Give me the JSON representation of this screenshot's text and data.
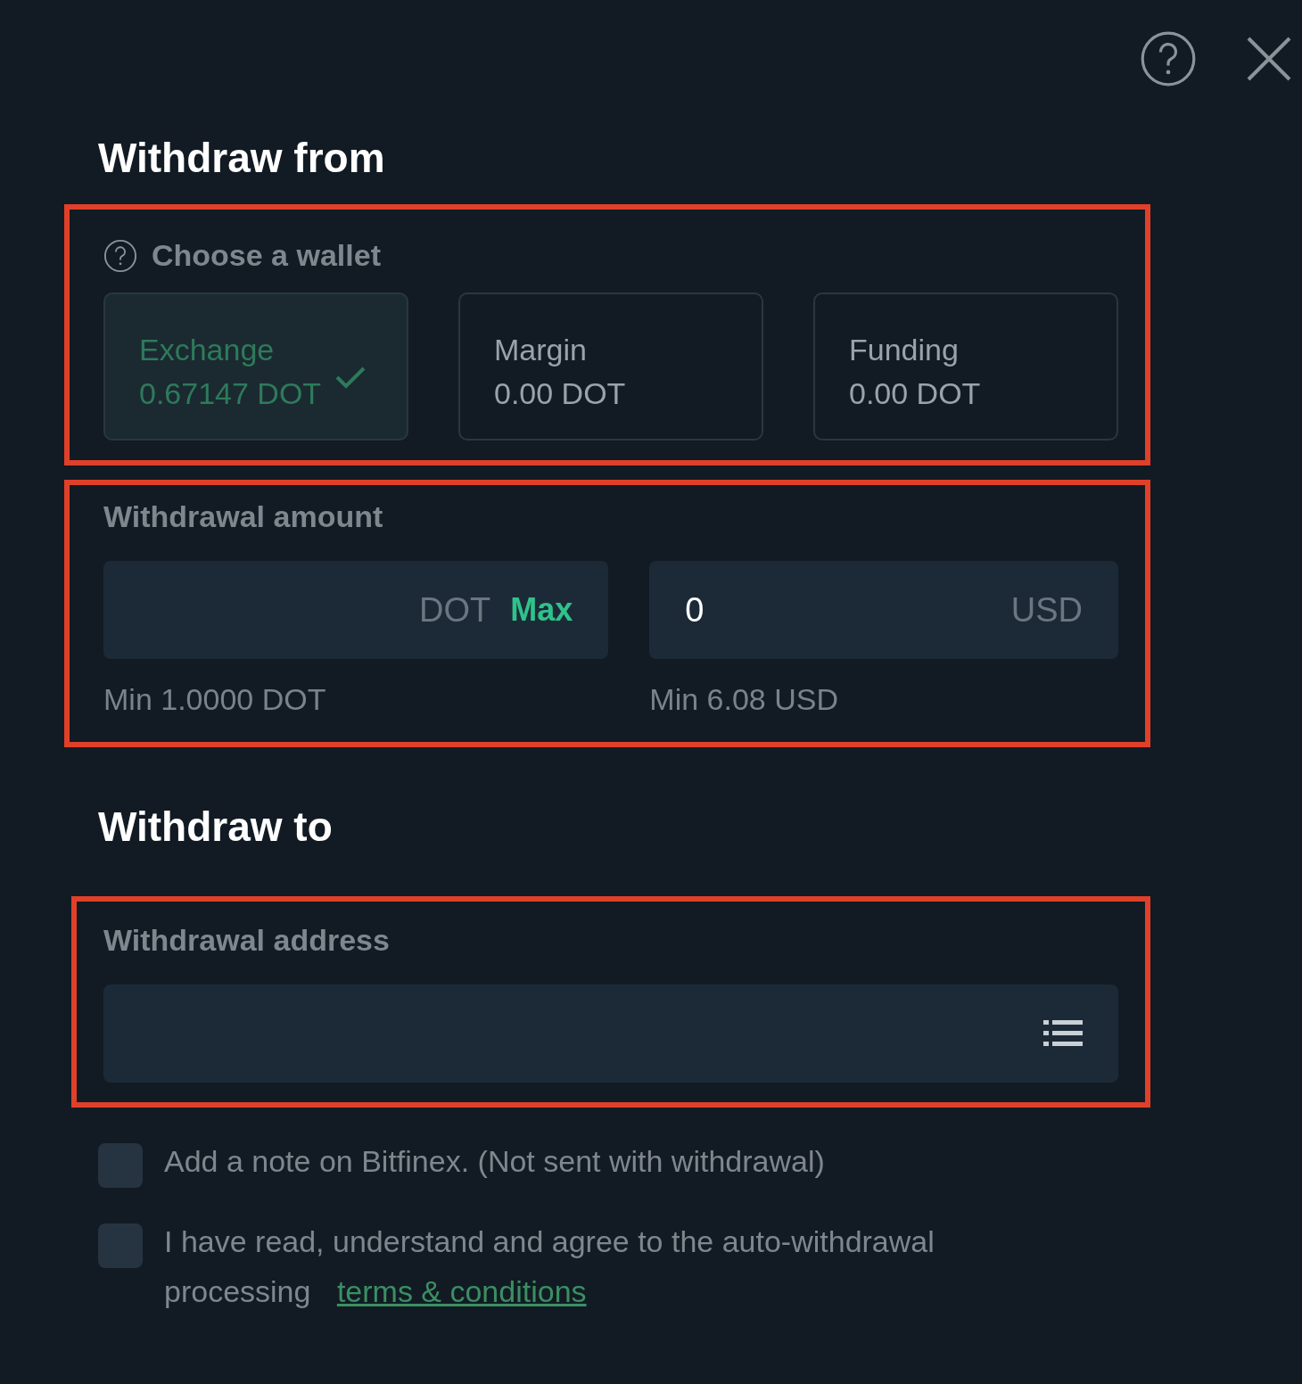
{
  "withdraw_from": {
    "title": "Withdraw from",
    "highlighted": true,
    "label": "Choose a wallet",
    "wallets": [
      {
        "name": "Exchange",
        "balance": "0.67147 DOT",
        "selected": true
      },
      {
        "name": "Margin",
        "balance": "0.00 DOT",
        "selected": false
      },
      {
        "name": "Funding",
        "balance": "0.00 DOT",
        "selected": false
      }
    ]
  },
  "amount": {
    "label": "Withdrawal amount",
    "highlighted": true,
    "fields": [
      {
        "kind": "crypto",
        "unit": "DOT",
        "max": "Max",
        "min": "Min 1.0000 DOT"
      },
      {
        "kind": "fiat",
        "value": "0",
        "unit": "USD",
        "min": "Min 6.08 USD"
      }
    ]
  },
  "withdraw_to": {
    "title": "Withdraw to"
  },
  "address": {
    "label": "Withdrawal address",
    "highlighted": true
  },
  "checkboxes": [
    {
      "text": "Add a note on Bitfinex. (Not sent with withdrawal)",
      "checked": false
    },
    {
      "text": "I have read, understand and agree to the auto-withdrawal processing",
      "link": "terms & conditions",
      "checked": false
    }
  ]
}
